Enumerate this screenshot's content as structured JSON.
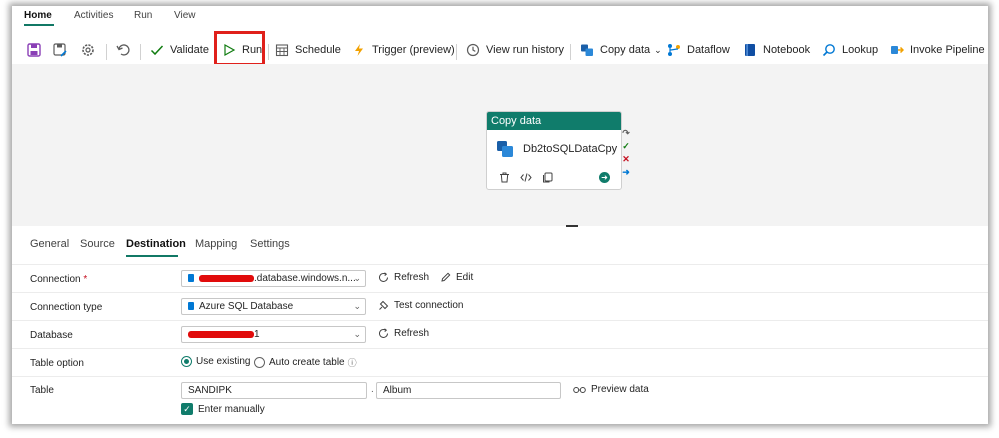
{
  "menu_tabs": [
    "Home",
    "Activities",
    "Run",
    "View"
  ],
  "toolbar": {
    "validate": "Validate",
    "run": "Run",
    "schedule": "Schedule",
    "trigger": "Trigger (preview)",
    "view_run_history": "View run history",
    "copy_data": "Copy data",
    "dataflow": "Dataflow",
    "notebook": "Notebook",
    "lookup": "Lookup",
    "invoke_pipeline": "Invoke Pipeline"
  },
  "activity": {
    "type": "Copy data",
    "name": "Db2toSQLDataCpy"
  },
  "panel_tabs": [
    "General",
    "Source",
    "Destination",
    "Mapping",
    "Settings"
  ],
  "active_panel_tab": "Destination",
  "properties": {
    "connection": {
      "label": "Connection",
      "required_mark": "*",
      "value_suffix": ".database.windows.n...",
      "refresh": "Refresh",
      "edit": "Edit"
    },
    "connection_type": {
      "label": "Connection type",
      "value": "Azure SQL Database",
      "test": "Test connection"
    },
    "database": {
      "label": "Database",
      "value_suffix": "1",
      "refresh": "Refresh"
    },
    "table_option": {
      "label": "Table option",
      "use_existing": "Use existing",
      "auto_create": "Auto create table",
      "selected": "Use existing"
    },
    "table": {
      "label": "Table",
      "schema": "SANDIPK",
      "separator": ".",
      "name": "Album",
      "preview": "Preview data",
      "enter_manually": "Enter manually",
      "enter_manually_checked": true
    }
  },
  "colors": {
    "accent": "#107c6b",
    "highlight": "#e0201b",
    "redaction": "#e10b0b"
  }
}
